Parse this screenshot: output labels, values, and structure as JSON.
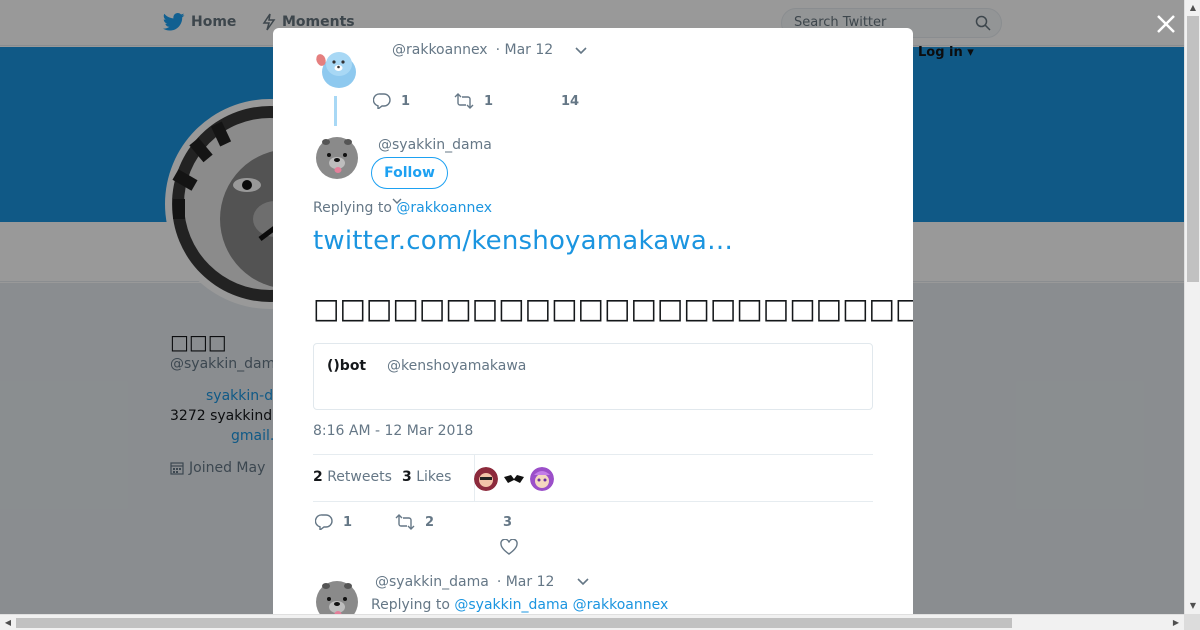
{
  "topnav": {
    "home_label": "Home",
    "moments_label": "Moments",
    "search_placeholder": "Search Twitter",
    "login_label": "Log in ▾"
  },
  "profile": {
    "name": "□□□",
    "handle": "@syakkin_dam",
    "bio_link": "syakkin-d",
    "bio_text": "3272 syakkind",
    "bio_mail": "gmail.",
    "joined": "Joined May"
  },
  "modal": {
    "parent_tweet": {
      "handle": "@rakkoannex",
      "date": "· Mar 12",
      "reply_count": "1",
      "retweet_count": "1",
      "like_count": "14"
    },
    "main_tweet": {
      "handle": "@syakkin_dama",
      "follow_label": "Follow",
      "replying_prefix": "Replying to",
      "replying_mention": "@rakkoannex",
      "link_text": "twitter.com/kenshoyamakawa…",
      "body_text": "□□□□□□□□□□□□□□□□□□□□□□□□□□□□□□□□□",
      "quote": {
        "name": "()bot",
        "handle": "@kenshoyamakawa"
      },
      "timestamp": "8:16 AM - 12 Mar 2018",
      "retweets_count": "2",
      "retweets_label": "Retweets",
      "likes_count": "3",
      "likes_label": "Likes",
      "reply_count": "1",
      "retweet_count": "2",
      "like_count": "3"
    },
    "reply_tweet": {
      "handle": "@syakkin_dama",
      "date": "· Mar 12",
      "replying_prefix": "Replying to",
      "mention_1": "@syakkin_dama",
      "mention_2": "@rakkoannex"
    }
  },
  "colors": {
    "brand_blue": "#1da1f2",
    "link_blue": "#1b95e0",
    "banner": "#1b95e0",
    "text_muted": "#657786"
  },
  "icons": [
    "twitter-bird-icon",
    "lightning-icon",
    "search-icon",
    "close-icon",
    "chevron-down-icon",
    "reply-icon",
    "retweet-icon",
    "heart-icon",
    "calendar-icon"
  ]
}
